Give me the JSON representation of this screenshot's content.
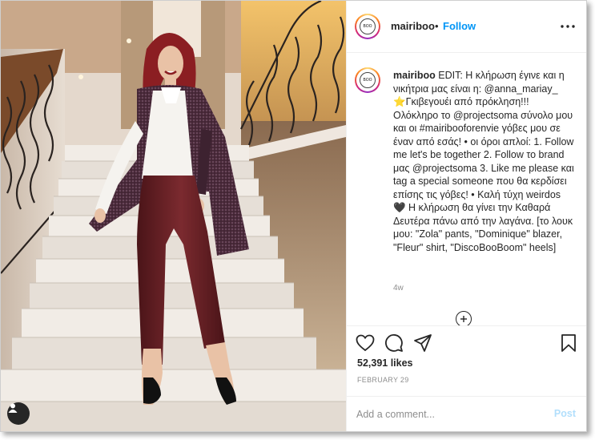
{
  "post": {
    "username": "mairiboo",
    "separator": "•",
    "follow_label": "Follow",
    "avatar_logo": "BOO",
    "caption_user": "mairiboo",
    "caption_text": " EDIT: Η κλήρωση έγινε και η νικήτρια μας είναι η: @anna_mariay_ ⭐Γκιβεγουέι από πρόκληση!!! Ολόκληρο το @projectsoma σύνολο μου και οι #mairibooforenvie γόβες μου σε έναν από εσάς! • οι όροι απλοί: 1. Follow me let's be together 2. Follow το brand μας @projectsoma 3. Like me please και tag a special someone που θα κερδίσει επίσης τις γόβες! • Καλή τύχη weirdos 🖤 Η κλήρωση θα γίνει την Καθαρά Δευτέρα πάνω από την λαγάνα. [το λουκ μου: \"Zola\" pants, \"Dominique\" blazer, \"Fleur\" shirt, \"DiscoBooBoom\" heels]",
    "time_ago": "4w",
    "likes": "52,391 likes",
    "date": "FEBRUARY 29"
  },
  "comment_box": {
    "placeholder": "Add a comment...",
    "post_label": "Post"
  },
  "icons": {
    "more": "more-options-icon",
    "like": "heart-icon",
    "comment": "comment-icon",
    "share": "paper-plane-icon",
    "save": "bookmark-icon",
    "load_more": "plus-circle-icon",
    "tag": "user-tag-icon"
  },
  "colors": {
    "link": "#0095f6",
    "post_disabled": "#b2dffc",
    "muted": "#8e8e8e",
    "text": "#262626"
  }
}
